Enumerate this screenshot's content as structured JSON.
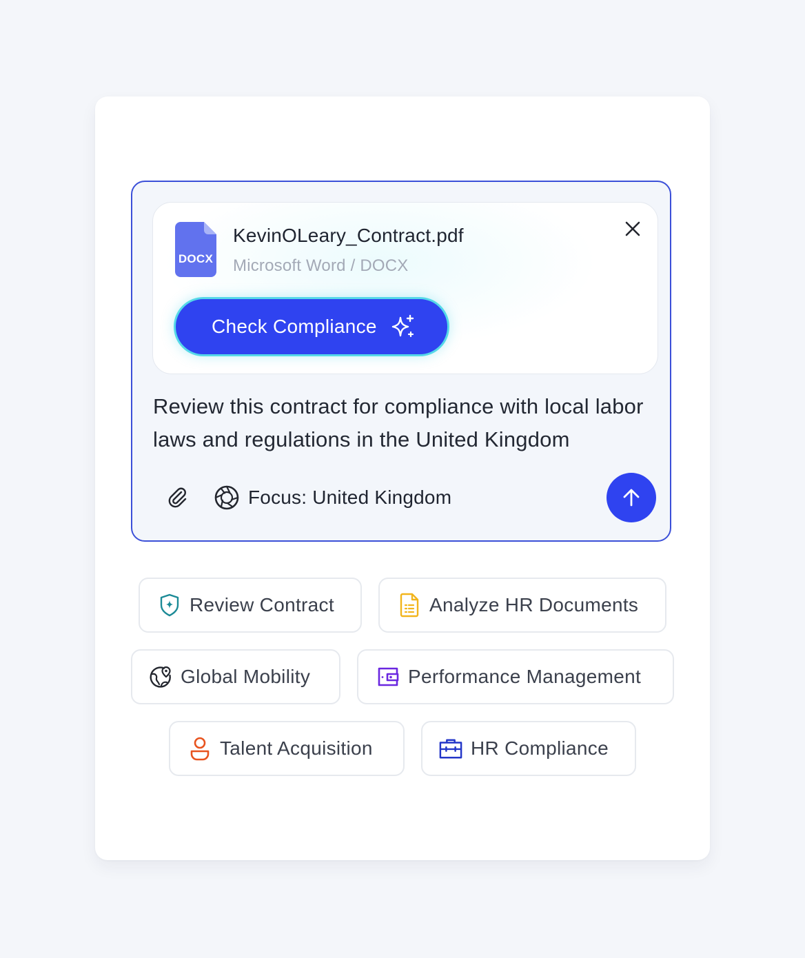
{
  "attachment": {
    "file_badge": "DOCX",
    "file_name": "KevinOLeary_Contract.pdf",
    "file_type": "Microsoft Word / DOCX",
    "action_label": "Check Compliance"
  },
  "prompt": {
    "text": "Review this contract for compliance with local labor laws and regulations in the United Kingdom"
  },
  "toolbar": {
    "focus_label": "Focus: United Kingdom"
  },
  "suggestions": [
    {
      "label": "Review Contract",
      "icon": "shield-sparkle-icon",
      "color": "#1b8a96"
    },
    {
      "label": "Analyze HR Documents",
      "icon": "document-icon",
      "color": "#f2b51c"
    },
    {
      "label": "Global Mobility",
      "icon": "globe-pin-icon",
      "color": "#23262e"
    },
    {
      "label": "Performance Management",
      "icon": "wallet-icon",
      "color": "#6a27e0"
    },
    {
      "label": "Talent Acquisition",
      "icon": "user-icon",
      "color": "#e8531e"
    },
    {
      "label": "HR Compliance",
      "icon": "briefcase-icon",
      "color": "#2336c8"
    }
  ],
  "colors": {
    "accent": "#2f43f0",
    "composer_border": "#3b4fd8",
    "button_glow": "#55d8e8",
    "file_icon": "#6172ee"
  }
}
